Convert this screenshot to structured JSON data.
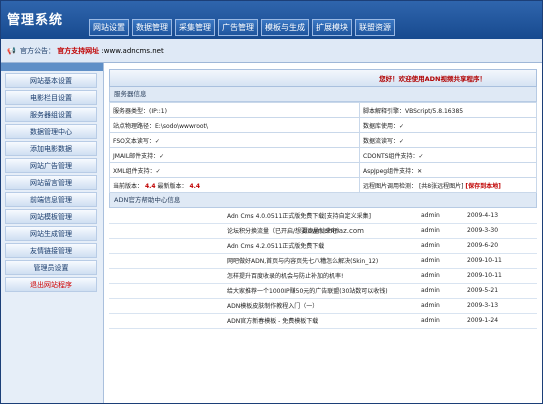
{
  "app": {
    "title": "管理系统"
  },
  "tabs": [
    "网站设置",
    "数据管理",
    "采集管理",
    "广告管理",
    "模板与生成",
    "扩展模块",
    "联盟资源"
  ],
  "notice": {
    "prefix": "官方公告：",
    "link_label": "官方支持网址",
    "url": ":www.adncms.net"
  },
  "sidebar": {
    "items": [
      "网站基本设置",
      "电影栏目设置",
      "服务器组设置",
      "数据管理中心",
      "添加电影数据",
      "网站广告管理",
      "网站留言管理",
      "前端信息管理",
      "网站模板管理",
      "网站生成管理",
      "友情链接管理",
      "管理员设置",
      "退出网站程序"
    ]
  },
  "main": {
    "welcome": "您好！欢迎使用ADN视频共享程序！",
    "server_section": "服务器信息",
    "rows": [
      [
        "服务器类型：(IP::1)",
        "脚本解释引擎：VBScript/5.8.16385"
      ],
      [
        "站点物理路径：E:\\sodo\\wwwroot\\",
        "数据库使用：✓"
      ],
      [
        "FSO文本读写：✓",
        "数据流读写：✓"
      ],
      [
        "JMAIL邮件支持：✓",
        "CDONTS组件支持：✓"
      ],
      [
        "XML组件支持：✓",
        "AspJpeg组件支持：✕"
      ]
    ],
    "version_label": "当前版本：",
    "current_version": "4.4",
    "latest_label": "最新版本：",
    "latest_version": "4.4",
    "remote_label": "远程图片调用检测：",
    "remote_value": "[共8张远程图片]",
    "remote_action": "[保存到本地]",
    "watermark": "down.chinaz.com",
    "help_section": "ADN官方帮助中心信息",
    "news": [
      {
        "title": "Adn Cms 4.0.0511正式版免费下载[支持自定义采集]",
        "author": "admin",
        "date": "2009-4-13"
      },
      {
        "title": "论坛积分换流量（已开启/想要流量就来吧）",
        "author": "admin",
        "date": "2009-3-30"
      },
      {
        "title": "Adn Cms 4.2.0511正式版免费下载",
        "author": "admin",
        "date": "2009-6-20"
      },
      {
        "title": "网吧做好ADN,首页与内容页先七八糟怎么解决(Skin_12)",
        "author": "admin",
        "date": "2009-10-11"
      },
      {
        "title": "怎样提升百度收录的机会与防止补加的机率!",
        "author": "admin",
        "date": "2009-10-11"
      },
      {
        "title": "给大家推荐一个1000IP赚50元的广告联盟(30站数可以收钱)",
        "author": "admin",
        "date": "2009-5-21"
      },
      {
        "title": "ADN模板皮肤制作教程入门（一）",
        "author": "admin",
        "date": "2009-3-13"
      },
      {
        "title": "ADN官方新春模板 - 免费模板下载",
        "author": "admin",
        "date": "2009-1-24"
      }
    ]
  }
}
